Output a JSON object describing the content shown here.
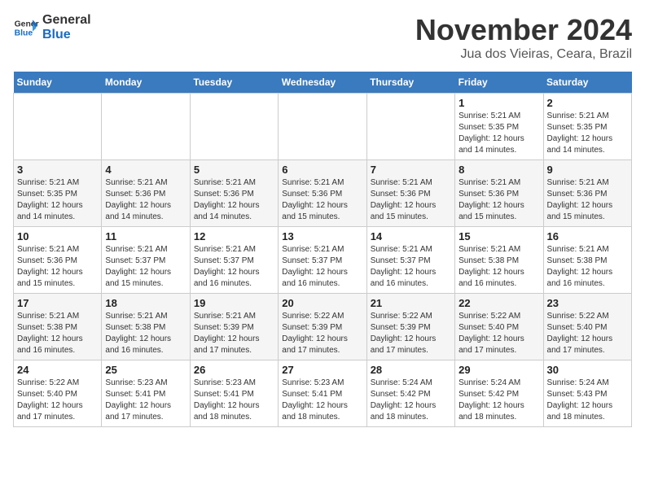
{
  "logo": {
    "text_general": "General",
    "text_blue": "Blue"
  },
  "header": {
    "month": "November 2024",
    "location": "Jua dos Vieiras, Ceara, Brazil"
  },
  "days_of_week": [
    "Sunday",
    "Monday",
    "Tuesday",
    "Wednesday",
    "Thursday",
    "Friday",
    "Saturday"
  ],
  "weeks": [
    [
      {
        "day": "",
        "info": ""
      },
      {
        "day": "",
        "info": ""
      },
      {
        "day": "",
        "info": ""
      },
      {
        "day": "",
        "info": ""
      },
      {
        "day": "",
        "info": ""
      },
      {
        "day": "1",
        "info": "Sunrise: 5:21 AM\nSunset: 5:35 PM\nDaylight: 12 hours and 14 minutes."
      },
      {
        "day": "2",
        "info": "Sunrise: 5:21 AM\nSunset: 5:35 PM\nDaylight: 12 hours and 14 minutes."
      }
    ],
    [
      {
        "day": "3",
        "info": "Sunrise: 5:21 AM\nSunset: 5:35 PM\nDaylight: 12 hours and 14 minutes."
      },
      {
        "day": "4",
        "info": "Sunrise: 5:21 AM\nSunset: 5:36 PM\nDaylight: 12 hours and 14 minutes."
      },
      {
        "day": "5",
        "info": "Sunrise: 5:21 AM\nSunset: 5:36 PM\nDaylight: 12 hours and 14 minutes."
      },
      {
        "day": "6",
        "info": "Sunrise: 5:21 AM\nSunset: 5:36 PM\nDaylight: 12 hours and 15 minutes."
      },
      {
        "day": "7",
        "info": "Sunrise: 5:21 AM\nSunset: 5:36 PM\nDaylight: 12 hours and 15 minutes."
      },
      {
        "day": "8",
        "info": "Sunrise: 5:21 AM\nSunset: 5:36 PM\nDaylight: 12 hours and 15 minutes."
      },
      {
        "day": "9",
        "info": "Sunrise: 5:21 AM\nSunset: 5:36 PM\nDaylight: 12 hours and 15 minutes."
      }
    ],
    [
      {
        "day": "10",
        "info": "Sunrise: 5:21 AM\nSunset: 5:36 PM\nDaylight: 12 hours and 15 minutes."
      },
      {
        "day": "11",
        "info": "Sunrise: 5:21 AM\nSunset: 5:37 PM\nDaylight: 12 hours and 15 minutes."
      },
      {
        "day": "12",
        "info": "Sunrise: 5:21 AM\nSunset: 5:37 PM\nDaylight: 12 hours and 16 minutes."
      },
      {
        "day": "13",
        "info": "Sunrise: 5:21 AM\nSunset: 5:37 PM\nDaylight: 12 hours and 16 minutes."
      },
      {
        "day": "14",
        "info": "Sunrise: 5:21 AM\nSunset: 5:37 PM\nDaylight: 12 hours and 16 minutes."
      },
      {
        "day": "15",
        "info": "Sunrise: 5:21 AM\nSunset: 5:38 PM\nDaylight: 12 hours and 16 minutes."
      },
      {
        "day": "16",
        "info": "Sunrise: 5:21 AM\nSunset: 5:38 PM\nDaylight: 12 hours and 16 minutes."
      }
    ],
    [
      {
        "day": "17",
        "info": "Sunrise: 5:21 AM\nSunset: 5:38 PM\nDaylight: 12 hours and 16 minutes."
      },
      {
        "day": "18",
        "info": "Sunrise: 5:21 AM\nSunset: 5:38 PM\nDaylight: 12 hours and 16 minutes."
      },
      {
        "day": "19",
        "info": "Sunrise: 5:21 AM\nSunset: 5:39 PM\nDaylight: 12 hours and 17 minutes."
      },
      {
        "day": "20",
        "info": "Sunrise: 5:22 AM\nSunset: 5:39 PM\nDaylight: 12 hours and 17 minutes."
      },
      {
        "day": "21",
        "info": "Sunrise: 5:22 AM\nSunset: 5:39 PM\nDaylight: 12 hours and 17 minutes."
      },
      {
        "day": "22",
        "info": "Sunrise: 5:22 AM\nSunset: 5:40 PM\nDaylight: 12 hours and 17 minutes."
      },
      {
        "day": "23",
        "info": "Sunrise: 5:22 AM\nSunset: 5:40 PM\nDaylight: 12 hours and 17 minutes."
      }
    ],
    [
      {
        "day": "24",
        "info": "Sunrise: 5:22 AM\nSunset: 5:40 PM\nDaylight: 12 hours and 17 minutes."
      },
      {
        "day": "25",
        "info": "Sunrise: 5:23 AM\nSunset: 5:41 PM\nDaylight: 12 hours and 17 minutes."
      },
      {
        "day": "26",
        "info": "Sunrise: 5:23 AM\nSunset: 5:41 PM\nDaylight: 12 hours and 18 minutes."
      },
      {
        "day": "27",
        "info": "Sunrise: 5:23 AM\nSunset: 5:41 PM\nDaylight: 12 hours and 18 minutes."
      },
      {
        "day": "28",
        "info": "Sunrise: 5:24 AM\nSunset: 5:42 PM\nDaylight: 12 hours and 18 minutes."
      },
      {
        "day": "29",
        "info": "Sunrise: 5:24 AM\nSunset: 5:42 PM\nDaylight: 12 hours and 18 minutes."
      },
      {
        "day": "30",
        "info": "Sunrise: 5:24 AM\nSunset: 5:43 PM\nDaylight: 12 hours and 18 minutes."
      }
    ]
  ]
}
